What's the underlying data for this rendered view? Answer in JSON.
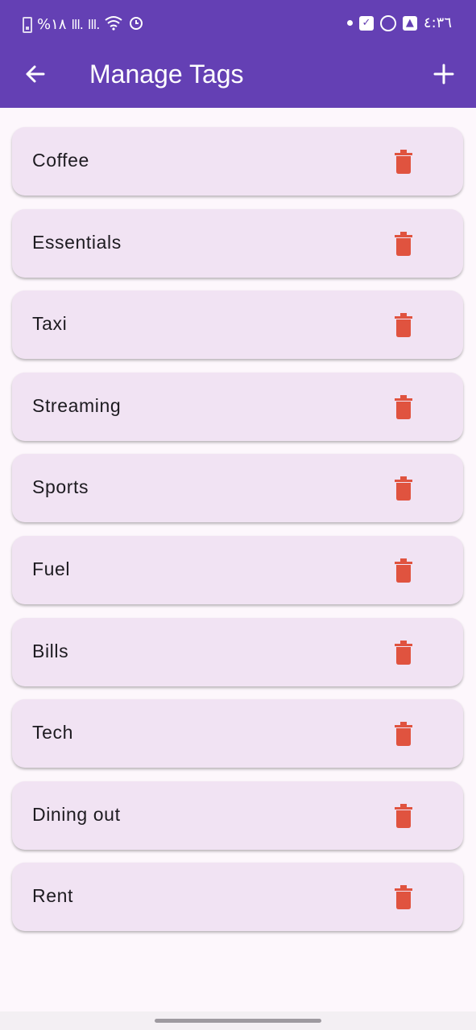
{
  "status_bar": {
    "left_text": "%١٨",
    "time": "٤:٣٦"
  },
  "appbar": {
    "title": "Manage Tags"
  },
  "tags": [
    {
      "label": "Coffee"
    },
    {
      "label": "Essentials"
    },
    {
      "label": "Taxi"
    },
    {
      "label": "Streaming"
    },
    {
      "label": "Sports"
    },
    {
      "label": "Fuel"
    },
    {
      "label": "Bills"
    },
    {
      "label": "Tech"
    },
    {
      "label": "Dining out"
    },
    {
      "label": "Rent"
    }
  ],
  "colors": {
    "app_bar": "#6440b4",
    "card_bg": "#f1e3f3",
    "delete_icon": "#e0533f",
    "page_bg": "#fdf7fc"
  },
  "icons": {
    "back": "arrow-left-icon",
    "add": "plus-icon",
    "delete": "trash-icon"
  }
}
